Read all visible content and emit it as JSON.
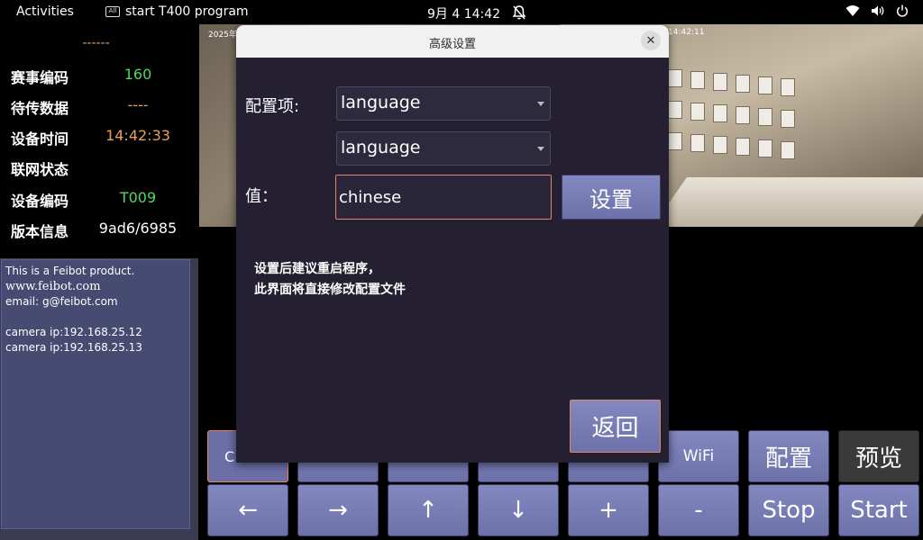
{
  "topbar": {
    "activities": "Activities",
    "app_icon_text": "All",
    "app_name": "start T400 program",
    "clock": "9月 4  14:42"
  },
  "left": {
    "dash": "------",
    "rows": [
      {
        "label": "赛事编码",
        "value": "160",
        "color": "#4cd964"
      },
      {
        "label": "待传数据",
        "value": "----",
        "color": "#e8a15b"
      },
      {
        "label": "设备时间",
        "value": "14:42:33",
        "color": "#e8a15b"
      },
      {
        "label": "联网状态",
        "value": "",
        "color": "#ffffff"
      },
      {
        "label": "设备编码",
        "value": "T009",
        "color": "#4cd964"
      },
      {
        "label": "版本信息",
        "value": "9ad6/6985",
        "color": "#ffffff"
      }
    ]
  },
  "infobox": {
    "line1": "This is a Feibot product.",
    "line2": "www.feibot.com",
    "line3": "email: g@feibot.com",
    "line4": "camera ip:192.168.25.12",
    "line5": "camera ip:192.168.25.13"
  },
  "camera": {
    "timestamp_left": "2025年",
    "timestamp_right": "14:42:11"
  },
  "buttons": {
    "row1": [
      "C",
      "",
      "",
      "",
      "",
      "WiFi",
      "配置",
      "预览"
    ],
    "row2": [
      "←",
      "→",
      "↑",
      "↓",
      "+",
      "-",
      "Stop",
      "Start"
    ]
  },
  "dialog": {
    "title": "高级设置",
    "config_label": "配置项:",
    "combo1": "language",
    "combo2": "language",
    "value_label": "值：",
    "value": "chinese",
    "set_button": "设置",
    "hint_line1": "设置后建议重启程序，",
    "hint_line2": "此界面将直接修改配置文件",
    "back_button": "返回"
  },
  "colors": {
    "accent_border": "#e8816b",
    "button_bg": "#7478b4",
    "dialog_bg": "#241f31"
  }
}
